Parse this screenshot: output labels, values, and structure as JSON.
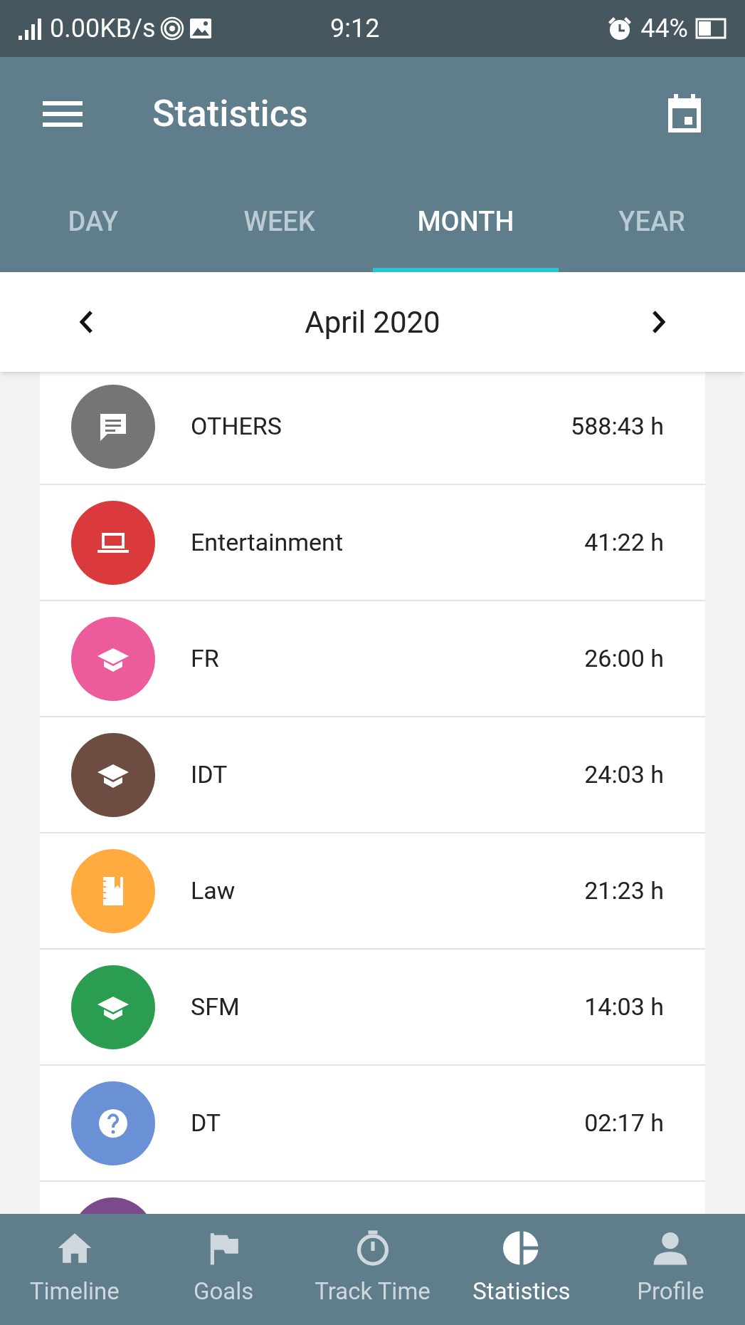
{
  "status_bar": {
    "speed": "0.00KB/s",
    "time": "9:12",
    "battery": "44%"
  },
  "app_bar": {
    "title": "Statistics"
  },
  "tabs": [
    {
      "label": "DAY",
      "selected": false
    },
    {
      "label": "WEEK",
      "selected": false
    },
    {
      "label": "MONTH",
      "selected": true
    },
    {
      "label": "YEAR",
      "selected": false
    }
  ],
  "period": {
    "label": "April 2020"
  },
  "categories": [
    {
      "kind": "chat",
      "name": "OTHERS",
      "time": "588:43 h",
      "color": "#757575"
    },
    {
      "kind": "laptop",
      "name": "Entertainment",
      "time": "41:22 h",
      "color": "#db3a3d"
    },
    {
      "kind": "school",
      "name": "FR",
      "time": "26:00 h",
      "color": "#ec5b9b"
    },
    {
      "kind": "school",
      "name": "IDT",
      "time": "24:03 h",
      "color": "#6d4c41"
    },
    {
      "kind": "notebook",
      "name": "Law",
      "time": "21:23 h",
      "color": "#ffab40"
    },
    {
      "kind": "school",
      "name": "SFM",
      "time": "14:03 h",
      "color": "#2a9d50"
    },
    {
      "kind": "help",
      "name": "DT",
      "time": "02:17 h",
      "color": "#6a90d6"
    },
    {
      "color": "#7b4a8c"
    }
  ],
  "bottom_nav": [
    {
      "kind": "home",
      "label": "Timeline",
      "selected": false
    },
    {
      "kind": "flag",
      "label": "Goals",
      "selected": false
    },
    {
      "kind": "timer",
      "label": "Track Time",
      "selected": false
    },
    {
      "kind": "pie",
      "label": "Statistics",
      "selected": true
    },
    {
      "kind": "person",
      "label": "Profile",
      "selected": false
    }
  ]
}
